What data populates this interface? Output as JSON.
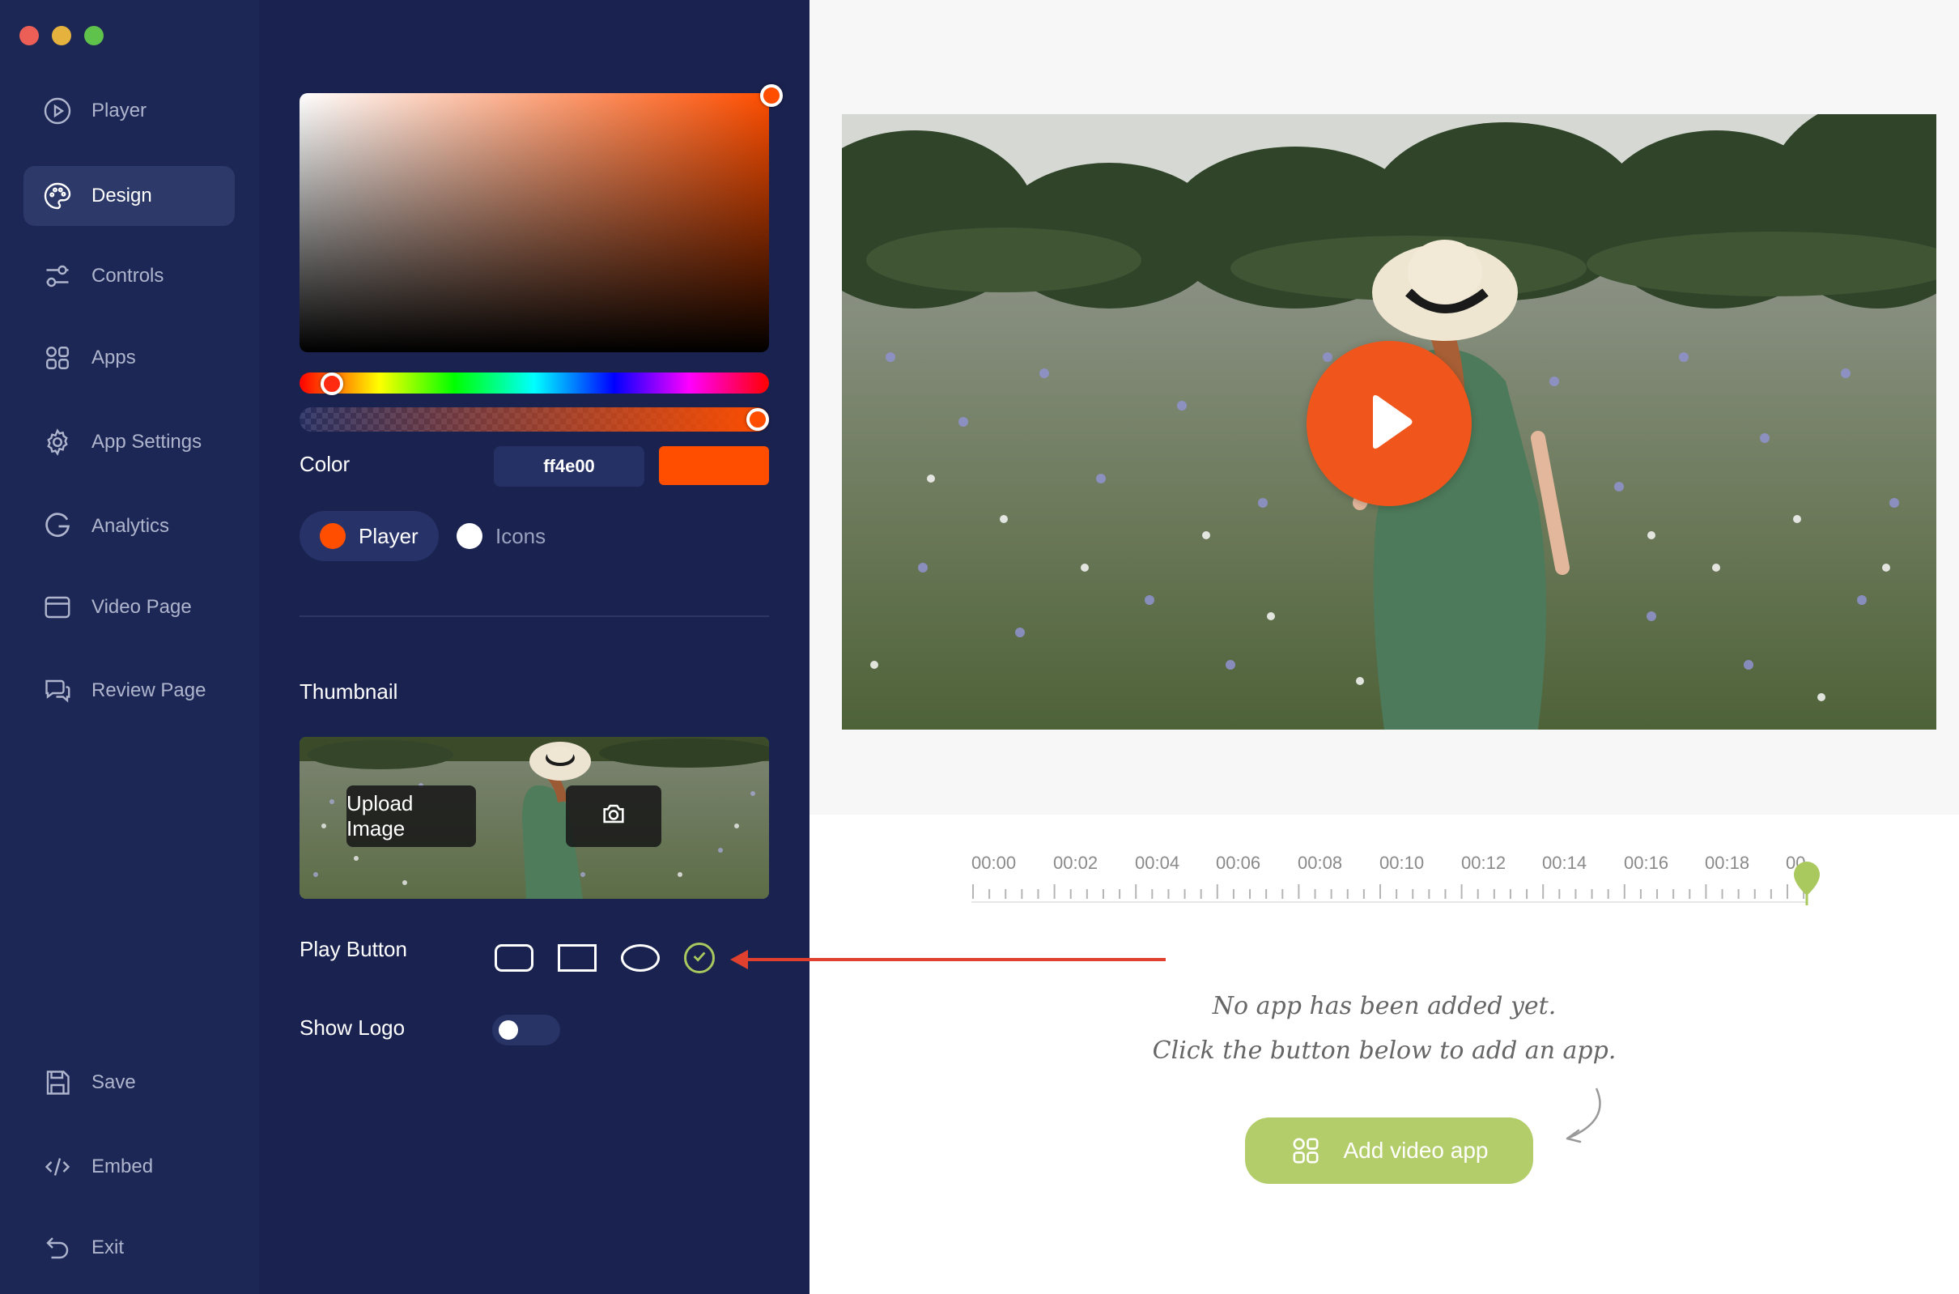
{
  "sidebar": {
    "window_controls": [
      "close",
      "minimize",
      "zoom"
    ],
    "items": [
      {
        "label": "Player",
        "icon": "play-circle-icon"
      },
      {
        "label": "Design",
        "icon": "palette-icon",
        "active": true
      },
      {
        "label": "Controls",
        "icon": "sliders-icon"
      },
      {
        "label": "Apps",
        "icon": "apps-grid-icon"
      },
      {
        "label": "App Settings",
        "icon": "gear-icon"
      },
      {
        "label": "Analytics",
        "icon": "analytics-g-icon"
      },
      {
        "label": "Video Page",
        "icon": "browser-window-icon"
      },
      {
        "label": "Review Page",
        "icon": "chat-bubbles-icon"
      }
    ],
    "bottom_items": [
      {
        "label": "Save",
        "icon": "floppy-disk-icon"
      },
      {
        "label": "Embed",
        "icon": "code-icon"
      },
      {
        "label": "Exit",
        "icon": "undo-arrow-icon"
      }
    ]
  },
  "design": {
    "color_label": "Color",
    "hex_value": "ff4e00",
    "selected_color": "#ff4e00",
    "alpha": 1.0,
    "targets": {
      "player_label": "Player",
      "icons_label": "Icons",
      "selected": "Player"
    },
    "thumbnail_label": "Thumbnail",
    "upload_label": "Upload Image",
    "play_button_label": "Play Button",
    "play_button_shapes": [
      "rounded-rectangle",
      "rectangle",
      "ellipse",
      "circle"
    ],
    "play_button_selected": "circle",
    "show_logo_label": "Show Logo",
    "show_logo_on": false
  },
  "preview": {
    "accent_color": "#f0561c"
  },
  "timeline": {
    "labels": [
      "00:00",
      "00:02",
      "00:04",
      "00:06",
      "00:08",
      "00:10",
      "00:12",
      "00:14",
      "00:16",
      "00:18",
      "00"
    ],
    "playhead_color": "#a9c95e"
  },
  "apps": {
    "empty_line1": "No app has been added yet.",
    "empty_line2": "Click the button below to add an app.",
    "add_button_label": "Add video app",
    "button_color": "#b3cd6b"
  }
}
